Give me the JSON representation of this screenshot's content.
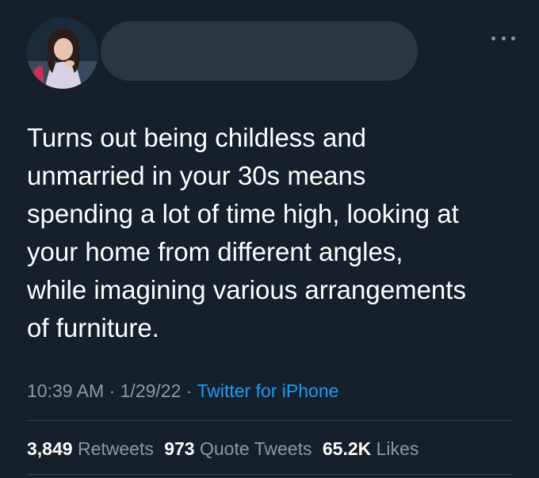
{
  "author": {
    "avatar_icon": "profile-photo-avatar",
    "name": ""
  },
  "tweet": {
    "text": "Turns out being childless and\nunmarried in your 30s means\nspending a lot of time high, looking at\nyour home from different angles,\nwhile imagining various arrangements\nof furniture."
  },
  "meta": {
    "time": "10:39 AM",
    "separator": "·",
    "date": "1/29/22",
    "source": "Twitter for iPhone"
  },
  "stats": {
    "retweets": {
      "count": "3,849",
      "label": "Retweets"
    },
    "quote_tweets": {
      "count": "973",
      "label": "Quote Tweets"
    },
    "likes": {
      "count": "65.2K",
      "label": "Likes"
    }
  },
  "colors": {
    "background": "#15202b",
    "text": "#ffffff",
    "muted": "#8b98a5",
    "link": "#1d9bf0",
    "divider": "#38444d"
  },
  "icons": {
    "more": "more-horizontal-icon"
  }
}
